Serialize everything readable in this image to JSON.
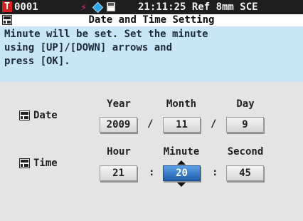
{
  "status": {
    "t_icon": "T",
    "instrument_number": "0001",
    "time": "21:11:25 Ref 8mm SCE"
  },
  "screen": {
    "title": "Date and Time Setting"
  },
  "message": {
    "line1": "Minute will be set. Set the minute",
    "line2": "using [UP]/[DOWN] arrows and",
    "line3": "press [OK]."
  },
  "date": {
    "label": "Date",
    "year_header": "Year",
    "month_header": "Month",
    "day_header": "Day",
    "year": "2009",
    "month": "11",
    "day": "9",
    "separator": "/"
  },
  "time": {
    "label": "Time",
    "hour_header": "Hour",
    "minute_header": "Minute",
    "second_header": "Second",
    "hour": "21",
    "minute": "20",
    "second": "45",
    "separator": ":"
  },
  "colors": {
    "selected_field": "#1f5fae",
    "message_background": "#c8e6f8",
    "panel_background": "#e4e4e4",
    "status_bar": "#1e1e1e",
    "t_icon": "#d42020"
  }
}
